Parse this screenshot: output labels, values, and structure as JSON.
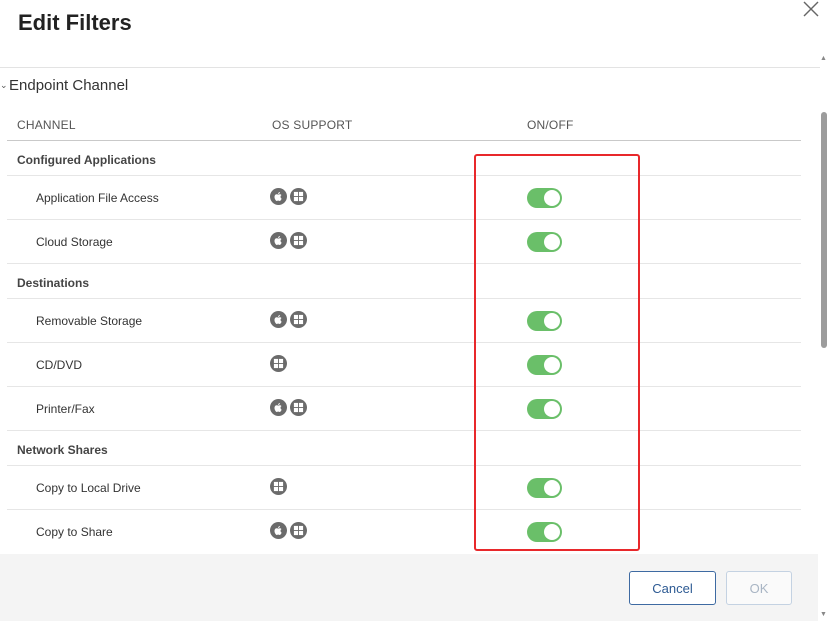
{
  "dialog": {
    "title": "Edit Filters"
  },
  "section": {
    "title": "Endpoint Channel",
    "expanded": true
  },
  "table": {
    "columns": {
      "channel": "CHANNEL",
      "os_support": "OS SUPPORT",
      "on_off": "ON/OFF"
    },
    "groups": [
      {
        "name": "Configured Applications",
        "items": [
          {
            "label": "Application File Access",
            "os": [
              "mac",
              "windows"
            ],
            "enabled": true
          },
          {
            "label": "Cloud Storage",
            "os": [
              "mac",
              "windows"
            ],
            "enabled": true
          }
        ]
      },
      {
        "name": "Destinations",
        "items": [
          {
            "label": "Removable Storage",
            "os": [
              "mac",
              "windows"
            ],
            "enabled": true
          },
          {
            "label": "CD/DVD",
            "os": [
              "windows"
            ],
            "enabled": true
          },
          {
            "label": "Printer/Fax",
            "os": [
              "mac",
              "windows"
            ],
            "enabled": true
          }
        ]
      },
      {
        "name": "Network Shares",
        "items": [
          {
            "label": "Copy to Local Drive",
            "os": [
              "windows"
            ],
            "enabled": true
          },
          {
            "label": "Copy to Share",
            "os": [
              "mac",
              "windows"
            ],
            "enabled": true
          }
        ]
      }
    ]
  },
  "footer": {
    "cancel_label": "Cancel",
    "ok_label": "OK"
  },
  "colors": {
    "toggle_on": "#6abf69",
    "highlight": "#e8282b",
    "primary_button": "#3e6aa2"
  },
  "icons": {
    "close": "close-icon",
    "mac": "apple-icon",
    "windows": "windows-icon",
    "chevron": "chevron-down-icon"
  }
}
